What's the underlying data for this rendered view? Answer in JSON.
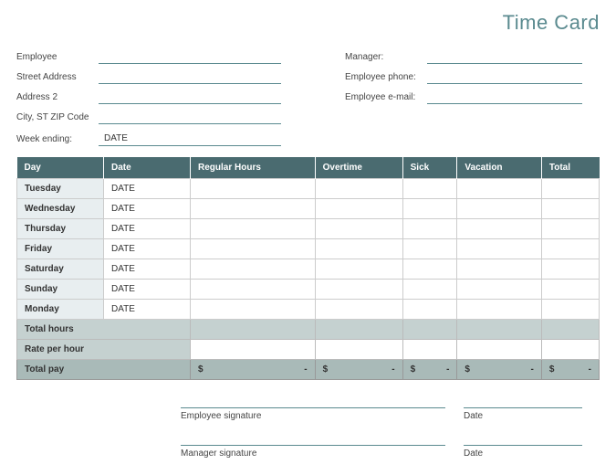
{
  "title": "Time Card",
  "info": {
    "left": [
      {
        "label": "Employee",
        "value": ""
      },
      {
        "label": "Street Address",
        "value": ""
      },
      {
        "label": "Address 2",
        "value": ""
      },
      {
        "label": "City, ST  ZIP Code",
        "value": ""
      }
    ],
    "right": [
      {
        "label": "Manager:",
        "value": ""
      },
      {
        "label": "Employee phone:",
        "value": ""
      },
      {
        "label": "Employee e-mail:",
        "value": ""
      }
    ]
  },
  "week_ending": {
    "label": "Week ending:",
    "value": "DATE"
  },
  "table": {
    "headers": [
      "Day",
      "Date",
      "Regular Hours",
      "Overtime",
      "Sick",
      "Vacation",
      "Total"
    ],
    "rows": [
      {
        "day": "Tuesday",
        "date": "DATE",
        "regular": "",
        "overtime": "",
        "sick": "",
        "vacation": "",
        "total": ""
      },
      {
        "day": "Wednesday",
        "date": "DATE",
        "regular": "",
        "overtime": "",
        "sick": "",
        "vacation": "",
        "total": ""
      },
      {
        "day": "Thursday",
        "date": "DATE",
        "regular": "",
        "overtime": "",
        "sick": "",
        "vacation": "",
        "total": ""
      },
      {
        "day": "Friday",
        "date": "DATE",
        "regular": "",
        "overtime": "",
        "sick": "",
        "vacation": "",
        "total": ""
      },
      {
        "day": "Saturday",
        "date": "DATE",
        "regular": "",
        "overtime": "",
        "sick": "",
        "vacation": "",
        "total": ""
      },
      {
        "day": "Sunday",
        "date": "DATE",
        "regular": "",
        "overtime": "",
        "sick": "",
        "vacation": "",
        "total": ""
      },
      {
        "day": "Monday",
        "date": "DATE",
        "regular": "",
        "overtime": "",
        "sick": "",
        "vacation": "",
        "total": ""
      }
    ],
    "total_hours_label": "Total hours",
    "rate_label": "Rate per hour",
    "total_pay_label": "Total pay",
    "money_prefix": "$",
    "money_dash": "-"
  },
  "signatures": {
    "emp_sig": "Employee signature",
    "mgr_sig": "Manager signature",
    "date": "Date"
  }
}
